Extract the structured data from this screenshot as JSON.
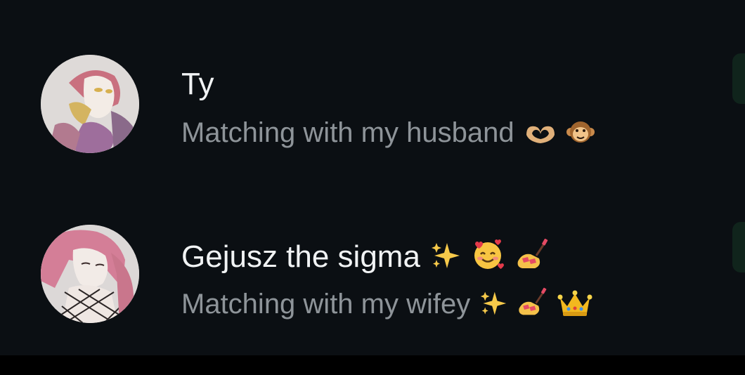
{
  "chats": [
    {
      "name": "Ty",
      "status": "Matching with my husband",
      "status_emojis": [
        "heart-hands",
        "monkey-face"
      ],
      "name_emojis": []
    },
    {
      "name": "Gejusz the sigma",
      "status": "Matching with my wifey",
      "name_emojis": [
        "sparkles",
        "smiling-face-with-hearts",
        "nail-polish"
      ],
      "status_emojis": [
        "sparkles",
        "nail-polish",
        "crown"
      ]
    }
  ],
  "colors": {
    "background": "#0b0f13",
    "name_text": "#f1f3f4",
    "status_text": "#8e9499",
    "accent_tab": "#10241c"
  }
}
